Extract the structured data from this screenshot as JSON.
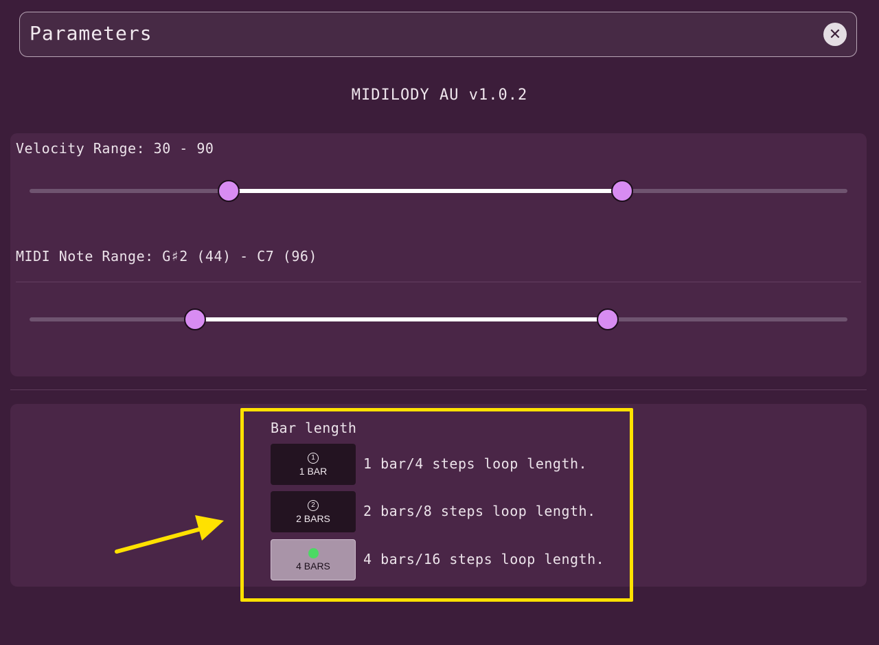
{
  "header": {
    "title": "Parameters",
    "close_icon": "✕"
  },
  "version": "MIDILODY AU v1.0.2",
  "velocity": {
    "label": "Velocity Range: 30 - 90",
    "low": 30,
    "high": 90,
    "min": 0,
    "max": 127
  },
  "note_range": {
    "label": "MIDI Note Range: G♯2 (44) - C7 (96)",
    "low": 44,
    "high": 96,
    "min": 21,
    "max": 127
  },
  "bar_length": {
    "title": "Bar length",
    "options": [
      {
        "icon": "1",
        "label": "1 BAR",
        "desc": "1 bar/4 steps loop length.",
        "selected": false
      },
      {
        "icon": "2",
        "label": "2 BARS",
        "desc": "2 bars/8 steps loop length.",
        "selected": false
      },
      {
        "icon": "selected-dot",
        "label": "4 BARS",
        "desc": "4 bars/16 steps loop length.",
        "selected": true
      }
    ]
  },
  "colors": {
    "background": "#3c1d3a",
    "panel": "#4a2647",
    "thumb": "#d88cf2",
    "highlight": "#ffe100",
    "selected_dot": "#4cd964"
  }
}
